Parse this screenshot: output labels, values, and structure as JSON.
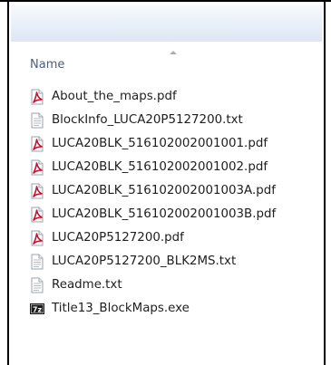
{
  "column": {
    "name_label": "Name"
  },
  "files": [
    {
      "name": "About_the_maps.pdf",
      "icon": "pdf-icon"
    },
    {
      "name": "BlockInfo_LUCA20P5127200.txt",
      "icon": "text-file-icon"
    },
    {
      "name": "LUCA20BLK_516102002001001.pdf",
      "icon": "pdf-icon"
    },
    {
      "name": "LUCA20BLK_516102002001002.pdf",
      "icon": "pdf-icon"
    },
    {
      "name": "LUCA20BLK_516102002001003A.pdf",
      "icon": "pdf-icon"
    },
    {
      "name": "LUCA20BLK_516102002001003B.pdf",
      "icon": "pdf-icon"
    },
    {
      "name": "LUCA20P5127200.pdf",
      "icon": "pdf-icon"
    },
    {
      "name": "LUCA20P5127200_BLK2MS.txt",
      "icon": "text-file-icon"
    },
    {
      "name": "Readme.txt",
      "icon": "text-file-icon"
    },
    {
      "name": "Title13_BlockMaps.exe",
      "icon": "7zip-icon",
      "icon_text": "7z"
    }
  ],
  "colors": {
    "pdf_red": "#c8102e",
    "header_text": "#4c607a",
    "toolbar_gradient_top": "#f7fafd",
    "toolbar_gradient_bottom": "#dde7f2"
  }
}
